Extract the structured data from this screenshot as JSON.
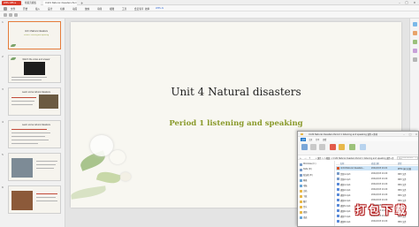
{
  "titlebar": {
    "app_tab": "WPS Office",
    "tab1": "找稻壳模板",
    "tab2": "Unit4 Natural disasters Peri",
    "add_tab": "+"
  },
  "menubar": {
    "items": [
      "文件",
      "开始",
      "插入",
      "设计",
      "切换",
      "动画",
      "放映",
      "审阅",
      "视图",
      "工具",
      "会员专享",
      "效率",
      "WPS AI"
    ]
  },
  "thumbnails": [
    {
      "num": "1",
      "title": "Unit 4 Natural disasters",
      "sub": "Period 1 listening and speaking"
    },
    {
      "num": "2",
      "title": "Watch the video and answer",
      "sub": ""
    },
    {
      "num": "3",
      "title": "Learn some natural disasters",
      "sub": ""
    },
    {
      "num": "4",
      "title": "Learn some natural disasters",
      "sub": ""
    },
    {
      "num": "5",
      "title": "",
      "sub": ""
    },
    {
      "num": "6",
      "title": "",
      "sub": ""
    }
  ],
  "slide": {
    "title": "Unit 4 Natural disasters",
    "subtitle": "Period 1 listening and speaking"
  },
  "explorer": {
    "title": "Unit4 Natural disasters Period 1 listening and speaking 课件+素材",
    "ribbon": [
      "文件",
      "主页",
      "共享",
      "查看"
    ],
    "address": "« 课件 > 人教版 > Unit4 Natural disasters Period 1 listening and speaking 课件+素材",
    "search_placeholder": "在 Unit4 Natural... 中搜索",
    "nav": [
      "Windows (C:)",
      "Data (D:)",
      "新加卷 (E:)",
      "网络",
      "电脑",
      "文档",
      "下载",
      "图片",
      "音乐",
      "视频",
      "桌面"
    ],
    "columns": [
      "名称",
      "修改日期",
      "类型"
    ],
    "files": [
      {
        "name": "Unit4 Natural disasters...",
        "date": "2024/4/13 10:21",
        "type": "PPTX 演示文稿"
      },
      {
        "name": "音频1.mp3",
        "date": "2024/4/13 10:20",
        "type": "MP3 文件"
      },
      {
        "name": "音频2.mp3",
        "date": "2024/4/13 10:20",
        "type": "MP3 文件"
      },
      {
        "name": "视频1.mp4",
        "date": "2024/4/13 10:20",
        "type": "MP4 文件"
      },
      {
        "name": "视频2.mp4",
        "date": "2024/4/13 10:20",
        "type": "MP4 文件"
      },
      {
        "name": "视频3.mp4",
        "date": "2024/4/13 10:20",
        "type": "MP4 文件"
      },
      {
        "name": "视频4.mp4",
        "date": "2024/4/13 10:20",
        "type": "MP4 文件"
      },
      {
        "name": "视频5.mp4",
        "date": "2024/4/13 10:20",
        "type": "MP4 文件"
      },
      {
        "name": "视频6.mp4",
        "date": "2024/4/13 10:20",
        "type": "MP4 文件"
      },
      {
        "name": "视频7.mp4",
        "date": "2024/4/13 10:20",
        "type": "MP4 文件"
      },
      {
        "name": "视频8.mp4",
        "date": "2024/4/13 10:20",
        "type": "MP4 文件"
      }
    ]
  },
  "watermark": {
    "text": "打包下载"
  },
  "colors": {
    "accent": "#d83b2b",
    "subtitle": "#8a9a2b",
    "thumb_active": "#e57c3b"
  }
}
